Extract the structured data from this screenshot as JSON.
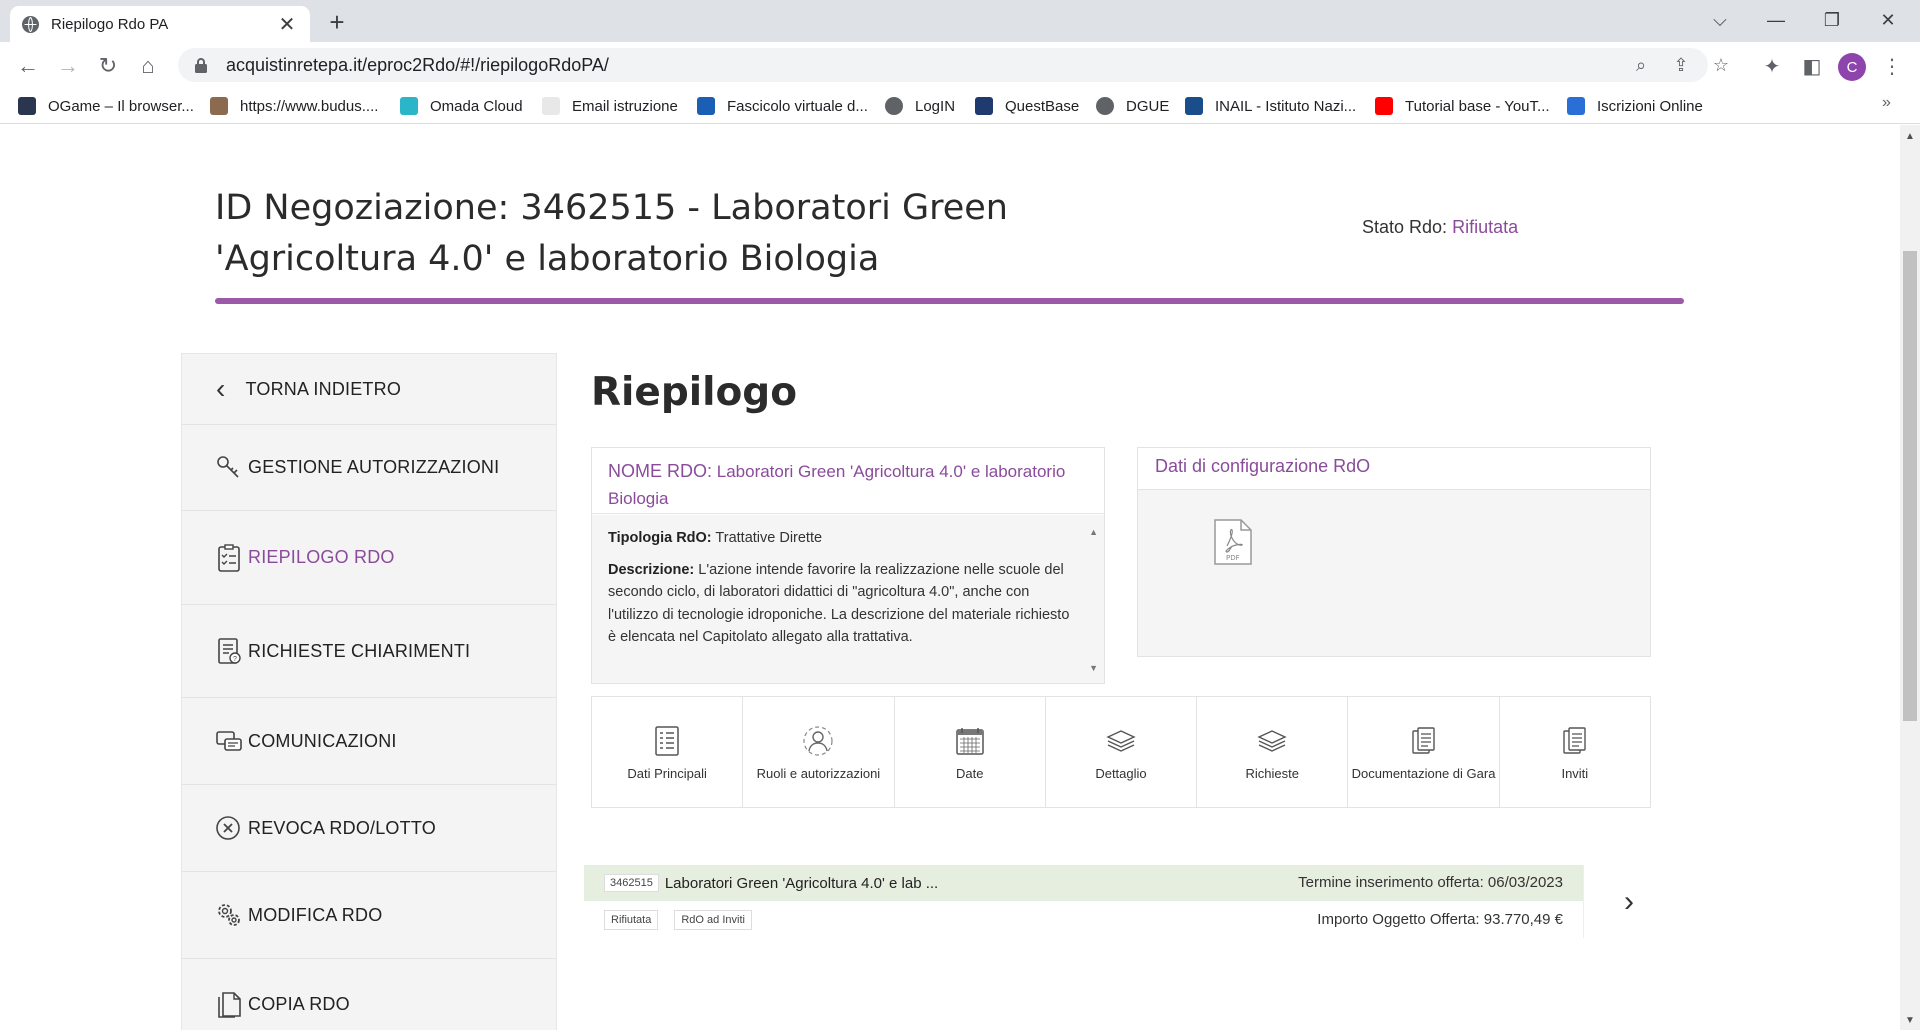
{
  "browser": {
    "tab_title": "Riepilogo Rdo PA",
    "url": "acquistinretepa.it/eproc2Rdo/#!/riepilogoRdoPA/",
    "profile_initial": "C",
    "bookmarks": [
      "OGame – Il browser...",
      "https://www.budus....",
      "Omada Cloud",
      "Email istruzione",
      "Fascicolo virtuale d...",
      "LogIN",
      "QuestBase",
      "DGUE",
      "INAIL - Istituto Nazi...",
      "Tutorial base - YouT...",
      "Iscrizioni Online"
    ]
  },
  "header": {
    "title": "ID Negoziazione: 3462515 - Laboratori Green 'Agricoltura 4.0' e laboratorio Biologia",
    "stato_label": "Stato Rdo:",
    "stato_value": "Rifiutata"
  },
  "sidebar": {
    "back": "TORNA INDIETRO",
    "items": [
      {
        "label": "GESTIONE AUTORIZZAZIONI",
        "icon": "keys-icon"
      },
      {
        "label": "RIEPILOGO RDO",
        "icon": "clipboard-checklist-icon"
      },
      {
        "label": "RICHIESTE CHIARIMENTI",
        "icon": "document-question-icon"
      },
      {
        "label": "COMUNICAZIONI",
        "icon": "chat-bubbles-icon"
      },
      {
        "label": "REVOCA RDO/LOTTO",
        "icon": "revoke-x-icon"
      },
      {
        "label": "MODIFICA RDO",
        "icon": "gears-icon"
      },
      {
        "label": "COPIA RDO",
        "icon": "copy-document-icon"
      }
    ]
  },
  "main": {
    "heading": "Riepilogo",
    "nome_card": {
      "label": "NOME RDO:",
      "value": "Laboratori Green 'Agricoltura 4.0' e laboratorio Biologia",
      "tipologia_label": "Tipologia RdO:",
      "tipologia_value": "Trattative Dirette",
      "descrizione_label": "Descrizione:",
      "descrizione_value": "L'azione intende favorire la realizzazione nelle scuole del secondo ciclo, di laboratori didattici di \"agricoltura 4.0\", anche con l'utilizzo di tecnologie idroponiche. La descrizione del materiale richiesto è elencata nel Capitolato allegato alla trattativa."
    },
    "config_card": {
      "title": "Dati di configurazione RdO",
      "file_label": "PDF"
    },
    "tiles": [
      {
        "label": "Dati Principali",
        "icon": "list-document-icon"
      },
      {
        "label": "Ruoli e autorizzazioni",
        "icon": "user-roles-icon"
      },
      {
        "label": "Date",
        "icon": "calendar-icon"
      },
      {
        "label": "Dettaglio",
        "icon": "layers-icon"
      },
      {
        "label": "Richieste",
        "icon": "layers-stack-icon"
      },
      {
        "label": "Documentazione di Gara",
        "icon": "documents-icon"
      },
      {
        "label": "Inviti",
        "icon": "invite-document-icon"
      }
    ],
    "lotto": {
      "id": "3462515",
      "name": "Laboratori Green 'Agricoltura 4.0' e lab ...",
      "termine": "Termine inserimento offerta: 06/03/2023",
      "tags": [
        "Rifiutata",
        "RdO ad Inviti"
      ],
      "importo": "Importo Oggetto Offerta: 93.770,49 €"
    }
  },
  "colors": {
    "accent_purple": "#8a4b9b",
    "rule_purple": "#9b59a8",
    "lotto_bg": "#e6eee0"
  }
}
